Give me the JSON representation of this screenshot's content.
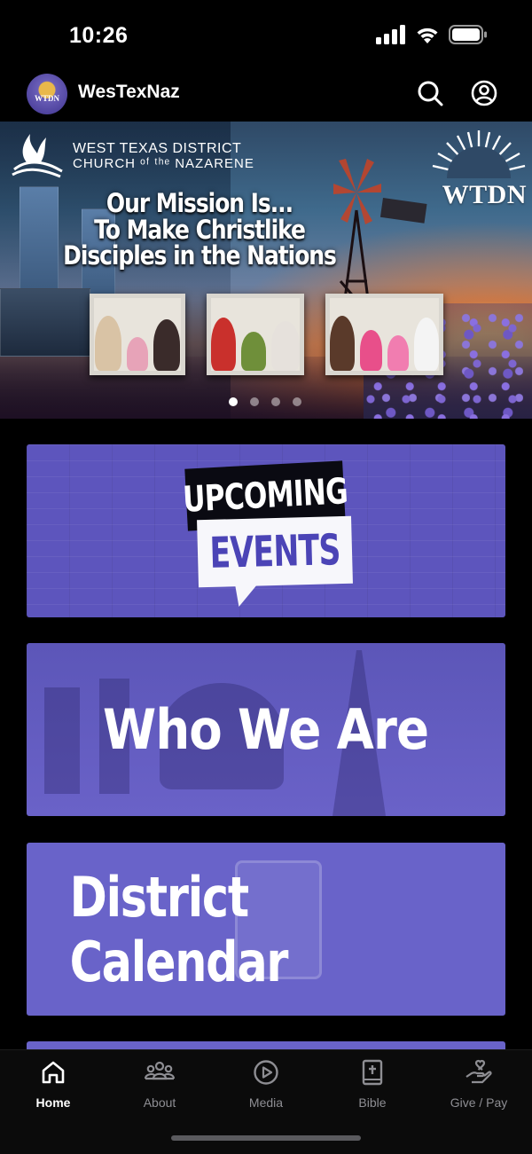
{
  "status_bar": {
    "time": "10:26"
  },
  "header": {
    "logo_text": "WTDN",
    "title": "WesTexNaz",
    "icons": [
      "search-icon",
      "account-icon"
    ]
  },
  "banner": {
    "district_line1": "WEST TEXAS DISTRICT",
    "district_line2": "CHURCH ᵒᶠ ᵗʰᵉ NAZARENE",
    "brand": "WTDN",
    "mission_lines": [
      "Our Mission Is...",
      "To Make Christlike",
      "Disciples in the Nations"
    ],
    "carousel": {
      "total": 4,
      "active_index": 0
    }
  },
  "cards": {
    "events_line1": "UPCOMING",
    "events_line2": "EVENTS",
    "who_we_are": "Who We Are",
    "district_calendar": "District Calendar"
  },
  "tab_bar": {
    "tabs": [
      {
        "label": "Home",
        "icon": "home-icon",
        "active": true
      },
      {
        "label": "About",
        "icon": "people-icon",
        "active": false
      },
      {
        "label": "Media",
        "icon": "play-icon",
        "active": false
      },
      {
        "label": "Bible",
        "icon": "bible-icon",
        "active": false
      },
      {
        "label": "Give / Pay",
        "icon": "give-icon",
        "active": false
      }
    ]
  },
  "colors": {
    "background": "#000000",
    "card_purple": "#6963c9",
    "tab_active": "#ffffff",
    "tab_inactive": "#8e8e93"
  }
}
